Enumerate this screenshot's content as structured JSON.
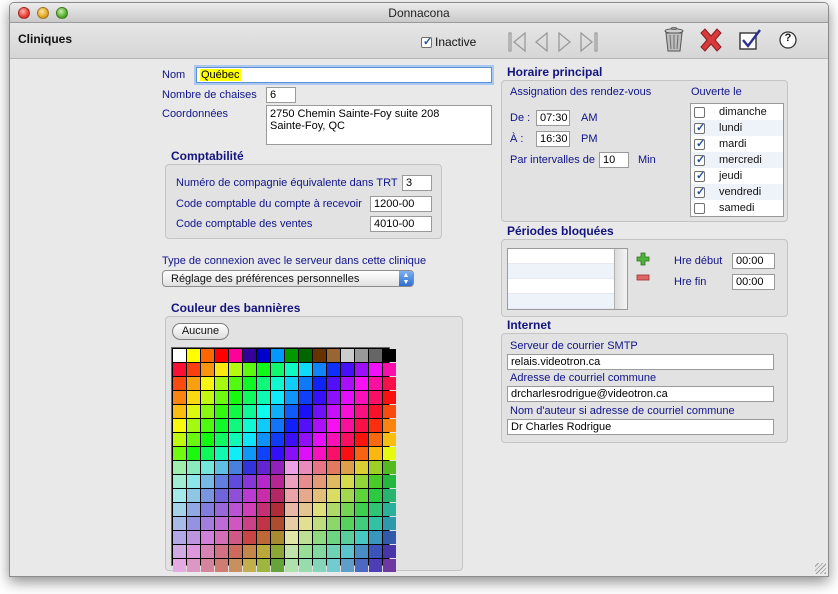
{
  "window": {
    "title": "Donnacona"
  },
  "toolbar": {
    "module_title": "Cliniques",
    "inactive_label": "Inactive",
    "inactive_checked": true
  },
  "identity": {
    "nom_label": "Nom",
    "nom_value": "Québec",
    "chaises_label": "Nombre de chaises",
    "chaises_value": "6",
    "coords_label": "Coordonnées",
    "coords_line1": "2750 Chemin Sainte-Foy suite 208",
    "coords_line2": "Sainte-Foy, QC"
  },
  "comptabilite": {
    "title": "Comptabilité",
    "trt_label": "Numéro de compagnie équivalente dans TRT",
    "trt_value": "3",
    "recevoir_label": "Code comptable du compte à recevoir",
    "recevoir_value": "1200-00",
    "ventes_label": "Code comptable des ventes",
    "ventes_value": "4010-00"
  },
  "connexion": {
    "label": "Type de connexion avec le serveur dans cette clinique",
    "selected": "Réglage des préférences personnelles"
  },
  "bannieres": {
    "title": "Couleur des bannières",
    "none_button": "Aucune"
  },
  "horaire": {
    "title": "Horaire principal",
    "assignation_label": "Assignation des rendez-vous",
    "ouverte_label": "Ouverte le",
    "de_label": "De :",
    "de_value": "07:30",
    "de_ampm": "AM",
    "a_label": "À :",
    "a_value": "16:30",
    "a_ampm": "PM",
    "intervalles_label": "Par intervalles de",
    "intervalles_value": "10",
    "intervalles_unit": "Min",
    "days": [
      {
        "label": "dimanche",
        "checked": false
      },
      {
        "label": "lundi",
        "checked": true
      },
      {
        "label": "mardi",
        "checked": true
      },
      {
        "label": "mercredi",
        "checked": true
      },
      {
        "label": "jeudi",
        "checked": true
      },
      {
        "label": "vendredi",
        "checked": true
      },
      {
        "label": "samedi",
        "checked": false
      }
    ]
  },
  "periodes": {
    "title": "Périodes bloquées",
    "debut_label": "Hre début",
    "debut_value": "00:00",
    "fin_label": "Hre fin",
    "fin_value": "00:00"
  },
  "internet": {
    "title": "Internet",
    "smtp_label": "Serveur de courrier SMTP",
    "smtp_value": "relais.videotron.ca",
    "email_label": "Adresse de courriel commune",
    "email_value": "drcharlesrodrigue@videotron.ca",
    "author_label": "Nom d'auteur si adresse de courriel commune",
    "author_value": "Dr Charles Rodrigue"
  },
  "icons": {
    "nav": [
      "first-record-icon",
      "previous-record-icon",
      "next-record-icon",
      "last-record-icon"
    ],
    "tools": [
      "trash-icon",
      "cancel-icon",
      "validate-icon",
      "help-icon"
    ],
    "help_glyph": "?"
  }
}
